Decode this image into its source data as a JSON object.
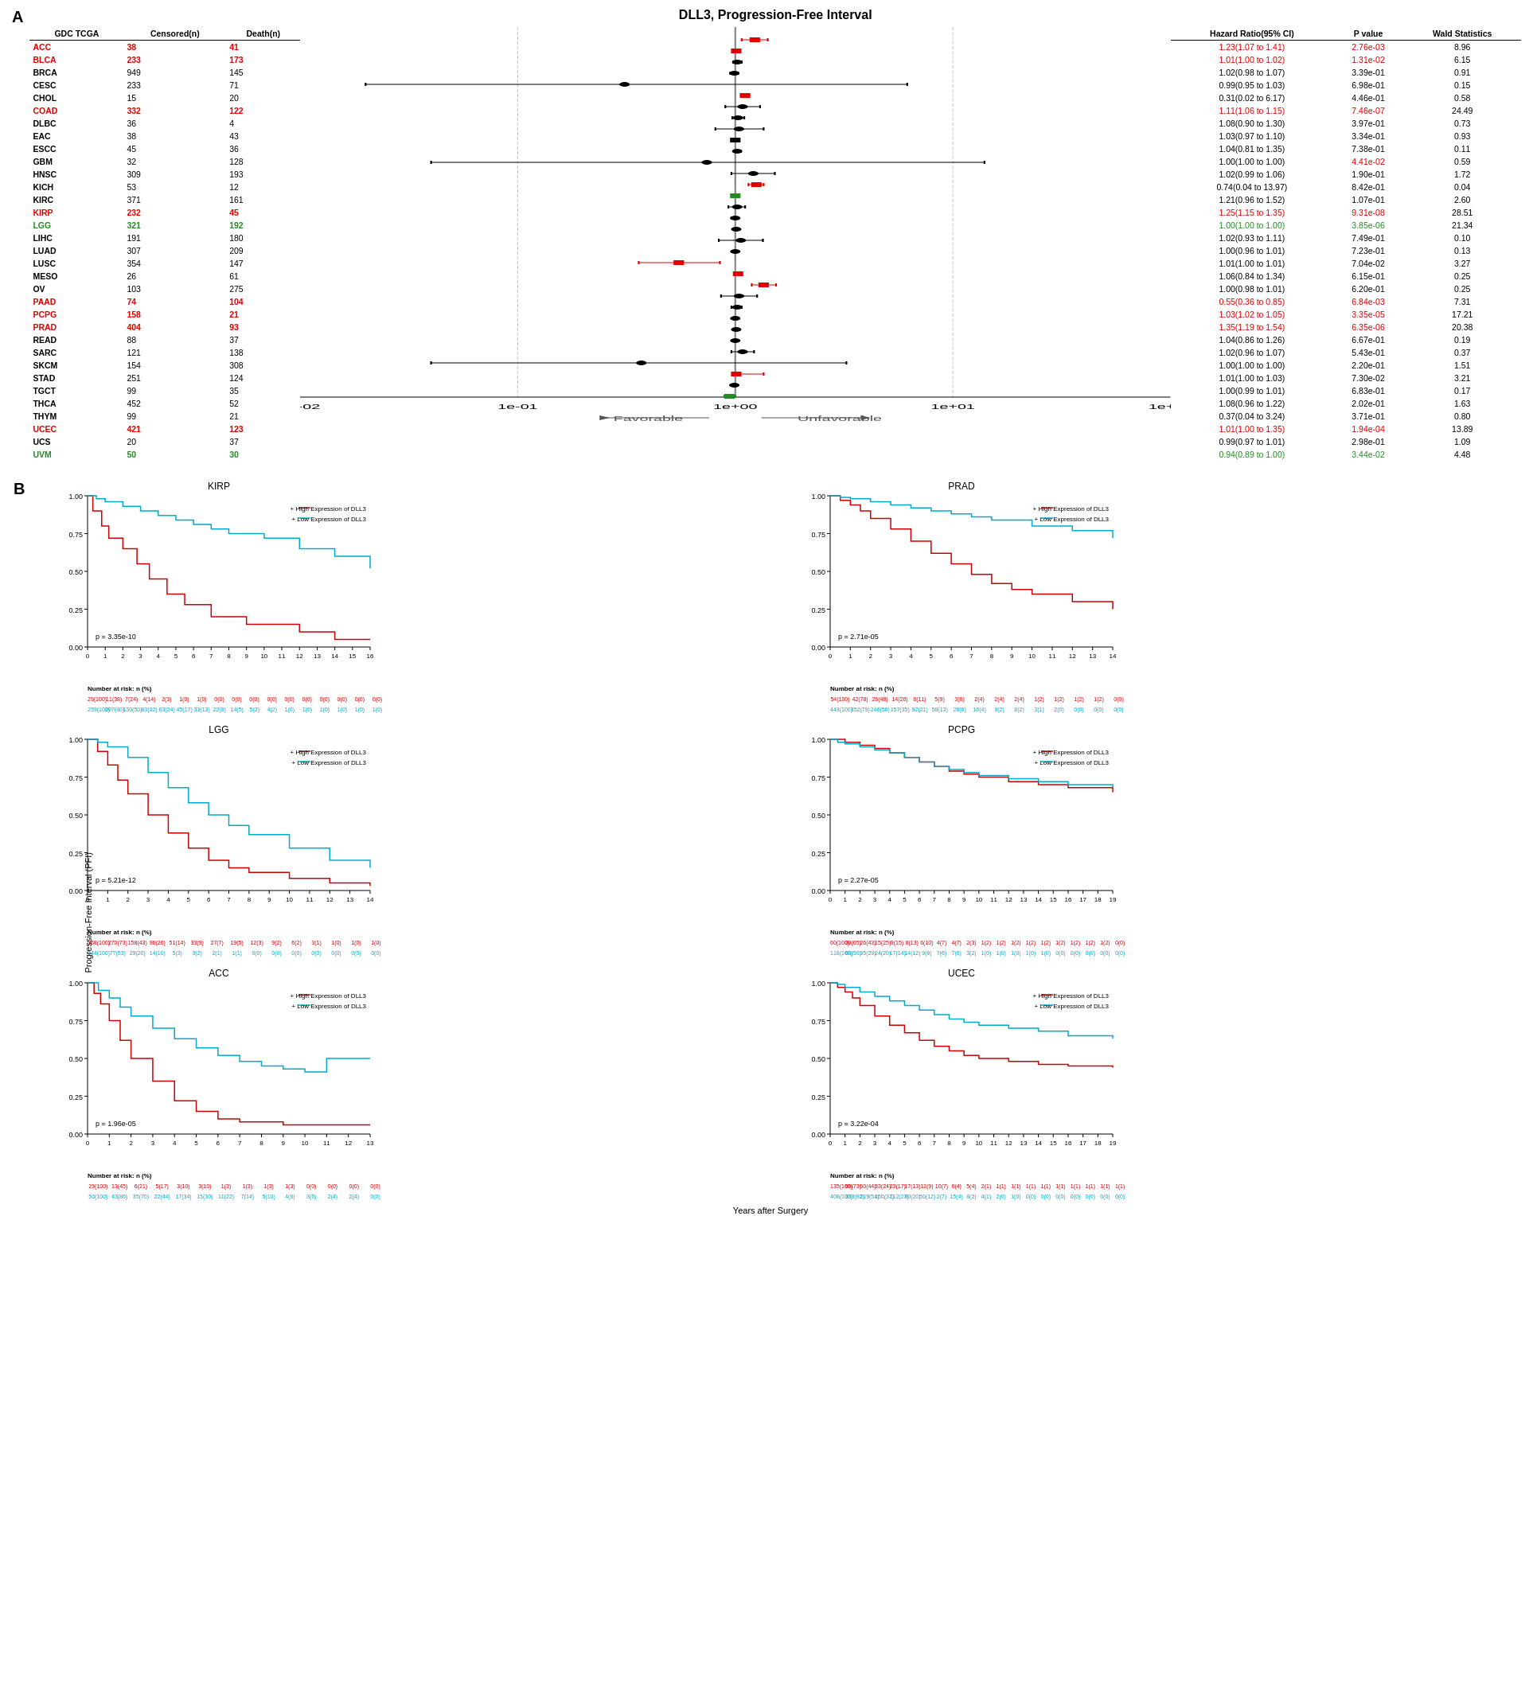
{
  "panelA": {
    "label": "A",
    "title": "DLL3, Progression-Free Interval",
    "tableHeaders": [
      "GDC TCGA",
      "Censored(n)",
      "Death(n)"
    ],
    "rightHeaders": [
      "Hazard Ratio(95% CI)",
      "P value",
      "Wald Statistics"
    ],
    "rows": [
      {
        "cancer": "ACC",
        "color": "red",
        "censored": 38,
        "death": 41,
        "hr": "1.23(1.07 to 1.41)",
        "pval": "2.76e-03",
        "wald": "8.96",
        "hrColor": "red"
      },
      {
        "cancer": "BLCA",
        "color": "red",
        "censored": 233,
        "death": 173,
        "hr": "1.01(1.00 to 1.02)",
        "pval": "1.31e-02",
        "wald": "6.15",
        "hrColor": "red"
      },
      {
        "cancer": "BRCA",
        "color": "black",
        "censored": 949,
        "death": 145,
        "hr": "1.02(0.98 to 1.07)",
        "pval": "3.39e-01",
        "wald": "0.91",
        "hrColor": "black"
      },
      {
        "cancer": "CESC",
        "color": "black",
        "censored": 233,
        "death": 71,
        "hr": "0.99(0.95 to 1.03)",
        "pval": "6.98e-01",
        "wald": "0.15",
        "hrColor": "black"
      },
      {
        "cancer": "CHOL",
        "color": "black",
        "censored": 15,
        "death": 20,
        "hr": "0.31(0.02 to 6.17)",
        "pval": "4.46e-01",
        "wald": "0.58",
        "hrColor": "black"
      },
      {
        "cancer": "COAD",
        "color": "red",
        "censored": 332,
        "death": 122,
        "hr": "1.11(1.06 to 1.15)",
        "pval": "7.46e-07",
        "wald": "24.49",
        "hrColor": "red"
      },
      {
        "cancer": "DLBC",
        "color": "black",
        "censored": 36,
        "death": 4,
        "hr": "1.08(0.90 to 1.30)",
        "pval": "3.97e-01",
        "wald": "0.73",
        "hrColor": "black"
      },
      {
        "cancer": "EAC",
        "color": "black",
        "censored": 38,
        "death": 43,
        "hr": "1.03(0.97 to 1.10)",
        "pval": "3.34e-01",
        "wald": "0.93",
        "hrColor": "black"
      },
      {
        "cancer": "ESCC",
        "color": "black",
        "censored": 45,
        "death": 36,
        "hr": "1.04(0.81 to 1.35)",
        "pval": "7.38e-01",
        "wald": "0.11",
        "hrColor": "black"
      },
      {
        "cancer": "GBM",
        "color": "black",
        "censored": 32,
        "death": 128,
        "hr": "1.00(1.00 to 1.00)",
        "pval": "4.41e-02",
        "wald": "0.59",
        "hrColor": "black"
      },
      {
        "cancer": "HNSC",
        "color": "black",
        "censored": 309,
        "death": 193,
        "hr": "1.02(0.99 to 1.06)",
        "pval": "1.90e-01",
        "wald": "1.72",
        "hrColor": "black"
      },
      {
        "cancer": "KICH",
        "color": "black",
        "censored": 53,
        "death": 12,
        "hr": "0.74(0.04 to 13.97)",
        "pval": "8.42e-01",
        "wald": "0.04",
        "hrColor": "black"
      },
      {
        "cancer": "KIRC",
        "color": "black",
        "censored": 371,
        "death": 161,
        "hr": "1.21(0.96 to 1.52)",
        "pval": "1.07e-01",
        "wald": "2.60",
        "hrColor": "black"
      },
      {
        "cancer": "KIRP",
        "color": "red",
        "censored": 232,
        "death": 45,
        "hr": "1.25(1.15 to 1.35)",
        "pval": "9.31e-08",
        "wald": "28.51",
        "hrColor": "red"
      },
      {
        "cancer": "LGG",
        "color": "green",
        "censored": 321,
        "death": 192,
        "hr": "1.00(1.00 to 1.00)",
        "pval": "3.85e-06",
        "wald": "21.34",
        "hrColor": "green"
      },
      {
        "cancer": "LIHC",
        "color": "black",
        "censored": 191,
        "death": 180,
        "hr": "1.02(0.93 to 1.11)",
        "pval": "7.49e-01",
        "wald": "0.10",
        "hrColor": "black"
      },
      {
        "cancer": "LUAD",
        "color": "black",
        "censored": 307,
        "death": 209,
        "hr": "1.00(0.96 to 1.01)",
        "pval": "7.23e-01",
        "wald": "0.13",
        "hrColor": "black"
      },
      {
        "cancer": "LUSC",
        "color": "black",
        "censored": 354,
        "death": 147,
        "hr": "1.01(1.00 to 1.01)",
        "pval": "7.04e-02",
        "wald": "3.27",
        "hrColor": "black"
      },
      {
        "cancer": "MESO",
        "color": "black",
        "censored": 26,
        "death": 61,
        "hr": "1.06(0.84 to 1.34)",
        "pval": "6.15e-01",
        "wald": "0.25",
        "hrColor": "black"
      },
      {
        "cancer": "OV",
        "color": "black",
        "censored": 103,
        "death": 275,
        "hr": "1.00(0.98 to 1.01)",
        "pval": "6.20e-01",
        "wald": "0.25",
        "hrColor": "black"
      },
      {
        "cancer": "PAAD",
        "color": "red",
        "censored": 74,
        "death": 104,
        "hr": "0.55(0.36 to 0.85)",
        "pval": "6.84e-03",
        "wald": "7.31",
        "hrColor": "red"
      },
      {
        "cancer": "PCPG",
        "color": "red",
        "censored": 158,
        "death": 21,
        "hr": "1.03(1.02 to 1.05)",
        "pval": "3.35e-05",
        "wald": "17.21",
        "hrColor": "red"
      },
      {
        "cancer": "PRAD",
        "color": "red",
        "censored": 404,
        "death": 93,
        "hr": "1.35(1.19 to 1.54)",
        "pval": "6.35e-06",
        "wald": "20.38",
        "hrColor": "red"
      },
      {
        "cancer": "READ",
        "color": "black",
        "censored": 88,
        "death": 37,
        "hr": "1.04(0.86 to 1.26)",
        "pval": "6.67e-01",
        "wald": "0.19",
        "hrColor": "black"
      },
      {
        "cancer": "SARC",
        "color": "black",
        "censored": 121,
        "death": 138,
        "hr": "1.02(0.96 to 1.07)",
        "pval": "5.43e-01",
        "wald": "0.37",
        "hrColor": "black"
      },
      {
        "cancer": "SKCM",
        "color": "black",
        "censored": 154,
        "death": 308,
        "hr": "1.00(1.00 to 1.00)",
        "pval": "2.20e-01",
        "wald": "1.51",
        "hrColor": "black"
      },
      {
        "cancer": "STAD",
        "color": "black",
        "censored": 251,
        "death": 124,
        "hr": "1.01(1.00 to 1.03)",
        "pval": "7.30e-02",
        "wald": "3.21",
        "hrColor": "black"
      },
      {
        "cancer": "TGCT",
        "color": "black",
        "censored": 99,
        "death": 35,
        "hr": "1.00(0.99 to 1.01)",
        "pval": "6.83e-01",
        "wald": "0.17",
        "hrColor": "black"
      },
      {
        "cancer": "THCA",
        "color": "black",
        "censored": 452,
        "death": 52,
        "hr": "1.08(0.96 to 1.22)",
        "pval": "2.02e-01",
        "wald": "1.63",
        "hrColor": "black"
      },
      {
        "cancer": "THYM",
        "color": "black",
        "censored": 99,
        "death": 21,
        "hr": "0.37(0.04 to 3.24)",
        "pval": "3.71e-01",
        "wald": "0.80",
        "hrColor": "black"
      },
      {
        "cancer": "UCEC",
        "color": "red",
        "censored": 421,
        "death": 123,
        "hr": "1.01(1.00 to 1.35)",
        "pval": "1.94e-04",
        "wald": "13.89",
        "hrColor": "red"
      },
      {
        "cancer": "UCS",
        "color": "black",
        "censored": 20,
        "death": 37,
        "hr": "0.99(0.97 to 1.01)",
        "pval": "2.98e-01",
        "wald": "1.09",
        "hrColor": "black"
      },
      {
        "cancer": "UVM",
        "color": "green",
        "censored": 50,
        "death": 30,
        "hr": "0.94(0.89 to 1.00)",
        "pval": "3.44e-02",
        "wald": "4.48",
        "hrColor": "green"
      }
    ]
  },
  "panelB": {
    "label": "B",
    "plots": [
      {
        "id": "kirp",
        "title": "KIRP",
        "pval": "p = 3.35e-10",
        "xmax": 16,
        "legendHigh": "High Expression of DLL3",
        "legendLow": "Low Expression of DLL3",
        "xLabel": "Years after Surgery",
        "yLabel": "Progression-Free Interval (PFI)",
        "atRisk": {
          "highLabel": "",
          "lowLabel": "",
          "highColor": "#cc0000",
          "lowColor": "#00aacc",
          "highValues": [
            "29(100)",
            "11(38)",
            "7(24)",
            "4(14)",
            "2(3)",
            "1(0)",
            "1(0)",
            "0(0)",
            "0(0)",
            "0(0)",
            "0(0)",
            "0(0)",
            "0(0)",
            "0(0)",
            "0(0)",
            "0(0)",
            "0(0)"
          ],
          "lowValues": [
            "259(100)",
            "207(80)",
            "130(50)",
            "83(32)",
            "63(24)",
            "45(17)",
            "33(13)",
            "22(8)",
            "14(5)",
            "5(2)",
            "4(2)",
            "1(0)",
            "1(0)",
            "1(0)",
            "1(0)",
            "1(0)",
            "1(0)"
          ]
        }
      },
      {
        "id": "prad",
        "title": "PRAD",
        "pval": "p = 2.71e-05",
        "xmax": 14,
        "legendHigh": "High Expression of DLL3",
        "legendLow": "Low Expression of DLL3",
        "atRisk": {
          "highColor": "#cc0000",
          "lowColor": "#00aacc",
          "highValues": [
            "54(100)",
            "42(78)",
            "26(48)",
            "14(26)",
            "8(11)",
            "5(9)",
            "3(6)",
            "2(4)",
            "2(4)",
            "2(4)",
            "1(2)",
            "1(2)",
            "1(2)",
            "1(2)",
            "0(0)"
          ],
          "lowValues": [
            "443(100)",
            "352(79)",
            "246(56)",
            "157(35)",
            "92(21)",
            "58(13)",
            "28(6)",
            "16(4)",
            "9(2)",
            "8(2)",
            "3(1)",
            "2(0)",
            "0(0)",
            "0(0)",
            "0(0)"
          ]
        }
      },
      {
        "id": "lgg",
        "title": "LGG",
        "pval": "p = 5.21e-12",
        "xmax": 14,
        "legendHigh": "High Expression of DLL3",
        "legendLow": "Low Expression of DLL3",
        "atRisk": {
          "highColor": "#cc0000",
          "lowColor": "#00aacc",
          "highValues": [
            "368(100)",
            "270(73)",
            "158(43)",
            "96(26)",
            "51(14)",
            "33(9)",
            "27(7)",
            "19(5)",
            "12(3)",
            "9(2)",
            "6(2)",
            "3(1)",
            "1(0)",
            "1(0)",
            "1(0)"
          ],
          "lowValues": [
            "144(100)",
            "77(53)",
            "29(20)",
            "14(10)",
            "5(3)",
            "3(2)",
            "2(1)",
            "1(1)",
            "0(0)",
            "0(0)",
            "0(0)",
            "0(0)",
            "0(0)",
            "0(0)",
            "0(0)"
          ]
        }
      },
      {
        "id": "pcpg",
        "title": "PCPG",
        "pval": "p = 2.27e-05",
        "xmax": 19,
        "legendHigh": "High Expression of DLL3",
        "legendLow": "Low Expression of DLL3",
        "atRisk": {
          "highColor": "#cc0000",
          "lowColor": "#00aacc",
          "highValues": [
            "60(100)",
            "39(65)",
            "26(43)",
            "15(25)",
            "9(15)",
            "8(13)",
            "6(10)",
            "4(7)",
            "4(7)",
            "2(3)",
            "1(2)",
            "1(2)",
            "1(2)",
            "1(2)",
            "1(2)",
            "1(2)",
            "1(2)",
            "1(2)",
            "1(2)",
            "0(0)"
          ],
          "lowValues": [
            "118(100)",
            "60(50)",
            "35(29)",
            "24(20)",
            "17(14)",
            "14(12)",
            "9(8)",
            "7(6)",
            "7(6)",
            "3(2)",
            "1(0)",
            "1(0)",
            "1(0)",
            "1(0)",
            "1(0)",
            "0(0)",
            "0(0)",
            "0(0)",
            "0(0)",
            "0(0)"
          ]
        }
      },
      {
        "id": "acc",
        "title": "ACC",
        "pval": "p = 1.96e-05",
        "xmax": 13,
        "legendHigh": "High Expression of DLL3",
        "legendLow": "Low Expression of DLL3",
        "atRisk": {
          "highColor": "#cc0000",
          "lowColor": "#00aacc",
          "highValues": [
            "29(100)",
            "13(45)",
            "6(21)",
            "5(17)",
            "3(10)",
            "3(10)",
            "1(3)",
            "1(3)",
            "1(3)",
            "1(3)",
            "0(0)",
            "0(0)",
            "0(0)",
            "0(0)"
          ],
          "lowValues": [
            "50(100)",
            "43(86)",
            "35(70)",
            "22(44)",
            "17(34)",
            "15(30)",
            "11(22)",
            "7(14)",
            "5(10)",
            "4(8)",
            "3(6)",
            "2(4)",
            "2(4)",
            "0(0)"
          ]
        }
      },
      {
        "id": "ucec",
        "title": "UCEC",
        "pval": "p = 3.22e-04",
        "xmax": 19,
        "legendHigh": "High Expression of DLL3",
        "legendLow": "Low Expression of DLL3",
        "atRisk": {
          "highColor": "#cc0000",
          "lowColor": "#00aacc",
          "highValues": [
            "135(100)",
            "99(73)",
            "60(44)",
            "33(24)",
            "23(17)",
            "17(13)",
            "12(9)",
            "10(7)",
            "6(4)",
            "5(4)",
            "2(1)",
            "1(1)",
            "1(1)",
            "1(1)",
            "1(1)",
            "1(1)",
            "1(1)",
            "1(1)",
            "1(1)",
            "1(1)"
          ],
          "lowValues": [
            "408(100)",
            "333(82)",
            "219(54)",
            "150(37)",
            "112(27)",
            "80(20)",
            "50(12)",
            "2(7)",
            "15(4)",
            "8(2)",
            "4(1)",
            "2(0)",
            "1(0)",
            "0(0)",
            "0(0)",
            "0(0)",
            "0(0)",
            "0(0)",
            "0(0)",
            "0(0)"
          ]
        }
      }
    ],
    "xAxisLabel": "Years after Surgery",
    "yAxisLabel": "Progression-Free Interval (PFI)"
  }
}
